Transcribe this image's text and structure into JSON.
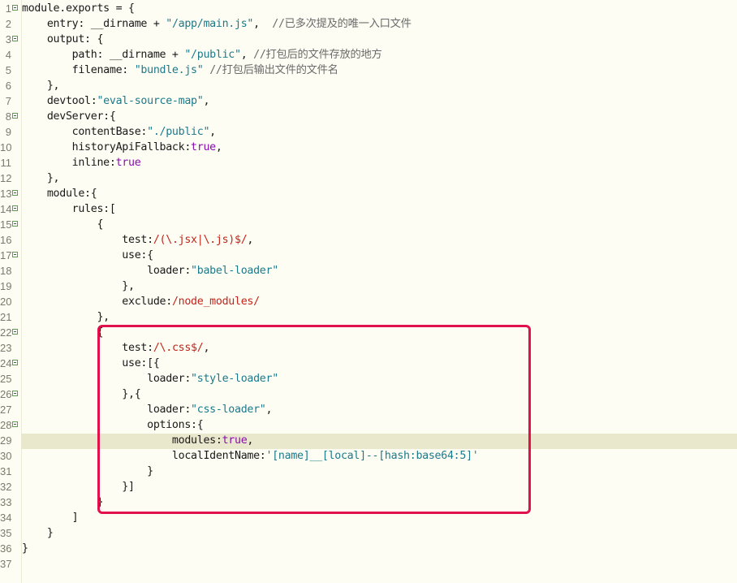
{
  "colors": {
    "background": "#fdfdf3",
    "current_line": "#e9e7cc",
    "plain": "#1a1a1a",
    "string": "#1c7a8c",
    "regex": "#c4241b",
    "keyword": "#8a0dad",
    "comment": "#6b6b6b",
    "annotation_box": "#e0114c"
  },
  "editor": {
    "current_line_number": "29",
    "lines": [
      {
        "n": "1",
        "fold": true,
        "tokens": [
          {
            "t": "module.exports = {",
            "c": "plain"
          }
        ]
      },
      {
        "n": "2",
        "fold": false,
        "tokens": [
          {
            "t": "    entry: __dirname + ",
            "c": "plain"
          },
          {
            "t": "\"/app/main.js\"",
            "c": "string"
          },
          {
            "t": ",  ",
            "c": "plain"
          },
          {
            "t": "//已多次提及的唯一入口文件",
            "c": "comment"
          }
        ]
      },
      {
        "n": "3",
        "fold": true,
        "tokens": [
          {
            "t": "    output: {",
            "c": "plain"
          }
        ]
      },
      {
        "n": "4",
        "fold": false,
        "tokens": [
          {
            "t": "        path: __dirname + ",
            "c": "plain"
          },
          {
            "t": "\"/public\"",
            "c": "string"
          },
          {
            "t": ", ",
            "c": "plain"
          },
          {
            "t": "//打包后的文件存放的地方",
            "c": "comment"
          }
        ]
      },
      {
        "n": "5",
        "fold": false,
        "tokens": [
          {
            "t": "        filename: ",
            "c": "plain"
          },
          {
            "t": "\"bundle.js\"",
            "c": "string"
          },
          {
            "t": " ",
            "c": "plain"
          },
          {
            "t": "//打包后输出文件的文件名",
            "c": "comment"
          }
        ]
      },
      {
        "n": "6",
        "fold": false,
        "tokens": [
          {
            "t": "    },",
            "c": "plain"
          }
        ]
      },
      {
        "n": "7",
        "fold": false,
        "tokens": [
          {
            "t": "    devtool:",
            "c": "plain"
          },
          {
            "t": "\"eval-source-map\"",
            "c": "string"
          },
          {
            "t": ",",
            "c": "plain"
          }
        ]
      },
      {
        "n": "8",
        "fold": true,
        "tokens": [
          {
            "t": "    devServer:{",
            "c": "plain"
          }
        ]
      },
      {
        "n": "9",
        "fold": false,
        "tokens": [
          {
            "t": "        contentBase:",
            "c": "plain"
          },
          {
            "t": "\"./public\"",
            "c": "string"
          },
          {
            "t": ",",
            "c": "plain"
          }
        ]
      },
      {
        "n": "10",
        "fold": false,
        "tokens": [
          {
            "t": "        historyApiFallback:",
            "c": "plain"
          },
          {
            "t": "true",
            "c": "keyword"
          },
          {
            "t": ",",
            "c": "plain"
          }
        ]
      },
      {
        "n": "11",
        "fold": false,
        "tokens": [
          {
            "t": "        inline:",
            "c": "plain"
          },
          {
            "t": "true",
            "c": "keyword"
          }
        ]
      },
      {
        "n": "12",
        "fold": false,
        "tokens": [
          {
            "t": "    },",
            "c": "plain"
          }
        ]
      },
      {
        "n": "13",
        "fold": true,
        "tokens": [
          {
            "t": "    module:{",
            "c": "plain"
          }
        ]
      },
      {
        "n": "14",
        "fold": true,
        "tokens": [
          {
            "t": "        rules:[",
            "c": "plain"
          }
        ]
      },
      {
        "n": "15",
        "fold": true,
        "tokens": [
          {
            "t": "            {",
            "c": "plain"
          }
        ]
      },
      {
        "n": "16",
        "fold": false,
        "tokens": [
          {
            "t": "                test:",
            "c": "plain"
          },
          {
            "t": "/(\\.jsx|\\.js)$/",
            "c": "regex"
          },
          {
            "t": ",",
            "c": "plain"
          }
        ]
      },
      {
        "n": "17",
        "fold": true,
        "tokens": [
          {
            "t": "                use:{",
            "c": "plain"
          }
        ]
      },
      {
        "n": "18",
        "fold": false,
        "tokens": [
          {
            "t": "                    loader:",
            "c": "plain"
          },
          {
            "t": "\"babel-loader\"",
            "c": "string"
          }
        ]
      },
      {
        "n": "19",
        "fold": false,
        "tokens": [
          {
            "t": "                },",
            "c": "plain"
          }
        ]
      },
      {
        "n": "20",
        "fold": false,
        "tokens": [
          {
            "t": "                exclude:",
            "c": "plain"
          },
          {
            "t": "/node_modules/",
            "c": "regex"
          }
        ]
      },
      {
        "n": "21",
        "fold": false,
        "tokens": [
          {
            "t": "            },",
            "c": "plain"
          }
        ]
      },
      {
        "n": "22",
        "fold": true,
        "tokens": [
          {
            "t": "            {",
            "c": "plain"
          }
        ]
      },
      {
        "n": "23",
        "fold": false,
        "tokens": [
          {
            "t": "                test:",
            "c": "plain"
          },
          {
            "t": "/\\.css$/",
            "c": "regex"
          },
          {
            "t": ",",
            "c": "plain"
          }
        ]
      },
      {
        "n": "24",
        "fold": true,
        "tokens": [
          {
            "t": "                use:[{",
            "c": "plain"
          }
        ]
      },
      {
        "n": "25",
        "fold": false,
        "tokens": [
          {
            "t": "                    loader:",
            "c": "plain"
          },
          {
            "t": "\"style-loader\"",
            "c": "string"
          }
        ]
      },
      {
        "n": "26",
        "fold": true,
        "tokens": [
          {
            "t": "                },{",
            "c": "plain"
          }
        ]
      },
      {
        "n": "27",
        "fold": false,
        "tokens": [
          {
            "t": "                    loader:",
            "c": "plain"
          },
          {
            "t": "\"css-loader\"",
            "c": "string"
          },
          {
            "t": ",",
            "c": "plain"
          }
        ]
      },
      {
        "n": "28",
        "fold": true,
        "tokens": [
          {
            "t": "                    options:{",
            "c": "plain"
          }
        ]
      },
      {
        "n": "29",
        "fold": false,
        "tokens": [
          {
            "t": "                        modules:",
            "c": "plain"
          },
          {
            "t": "true",
            "c": "keyword"
          },
          {
            "t": ",",
            "c": "plain"
          }
        ]
      },
      {
        "n": "30",
        "fold": false,
        "tokens": [
          {
            "t": "                        localIdentName:",
            "c": "plain"
          },
          {
            "t": "'[name]__[local]--[hash:base64:5]'",
            "c": "string"
          }
        ]
      },
      {
        "n": "31",
        "fold": false,
        "tokens": [
          {
            "t": "                    }",
            "c": "plain"
          }
        ]
      },
      {
        "n": "32",
        "fold": false,
        "tokens": [
          {
            "t": "                }]",
            "c": "plain"
          }
        ]
      },
      {
        "n": "33",
        "fold": false,
        "tokens": [
          {
            "t": "            }",
            "c": "plain"
          }
        ]
      },
      {
        "n": "34",
        "fold": false,
        "tokens": [
          {
            "t": "        ]",
            "c": "plain"
          }
        ]
      },
      {
        "n": "35",
        "fold": false,
        "tokens": [
          {
            "t": "    }",
            "c": "plain"
          }
        ]
      },
      {
        "n": "36",
        "fold": false,
        "tokens": [
          {
            "t": "}",
            "c": "plain"
          }
        ]
      },
      {
        "n": "37",
        "fold": false,
        "tokens": []
      }
    ]
  },
  "annotation": {
    "from_line": "22",
    "to_line": "33",
    "style": "red rounded rectangle"
  }
}
